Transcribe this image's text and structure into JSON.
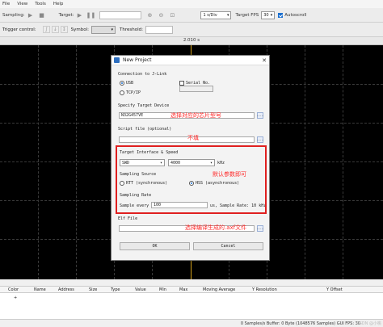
{
  "menu": [
    "File",
    "View",
    "Tools",
    "Help"
  ],
  "toolbar": {
    "sampling_label": "Sampling:",
    "target_label": "Target:",
    "time_div": "1 s/Div",
    "target_fps_label": "Target FPS",
    "target_fps_value": "30",
    "autoscroll_label": "Autoscroll"
  },
  "trigger": {
    "control_label": "Trigger control:",
    "symbol_label": "Symbol:",
    "threshold_label": "Threshold:"
  },
  "timeline": {
    "label": "2.010 s"
  },
  "dialog": {
    "title": "New Project",
    "connection_group": "Connection to J-Link",
    "usb_label": "USB",
    "serial_label": "Serial No.",
    "tcpip_label": "TCP/IP",
    "device_group": "Specify Target Device",
    "device_value": "N32G457VE",
    "script_group": "Script file (optional)",
    "interface_group": "Target Interface & Speed",
    "interface_value": "SWD",
    "speed_value": "4000",
    "speed_unit": "kHz",
    "sampling_source_group": "Sampling Source",
    "rtt_label": "RTT (synchronous)",
    "hss_label": "HSS (asynchronous)",
    "sampling_rate_group": "Sampling Rate",
    "sample_every_label": "Sample every",
    "sample_every_value": "100",
    "sample_rate_text": "us, Sample Rate: 10 kHz",
    "elf_group": "Elf File",
    "ok_label": "OK",
    "cancel_label": "Cancel",
    "browse_label": "..."
  },
  "annotations": {
    "device_note": "选择对应的芯片型号",
    "script_note": "不填",
    "defaults_note": "默认参数即可",
    "elf_note": "选择编译生成的.axf文件"
  },
  "table": {
    "columns": [
      "Color",
      "Name",
      "Address",
      "Size",
      "Type",
      "Value",
      "Min",
      "Max",
      "Moving Average",
      "Y Resolution",
      "Y Offset"
    ]
  },
  "status": {
    "text": "0 Samples/s  Buffer: 0 Byte (1048576 Samples)  GUI FPS: 30",
    "watermark": "CSDN @小桃"
  },
  "colors": {
    "annotation_red": "#ff2a2a",
    "cursor": "#d5a21a",
    "accent": "#1a6fd0"
  }
}
